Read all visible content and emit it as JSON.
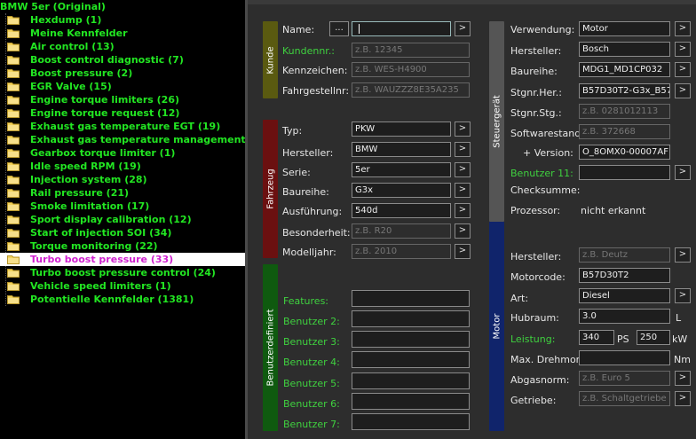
{
  "tree": {
    "root": "BMW 5er (Original)",
    "items": [
      "Hexdump (1)",
      "Meine Kennfelder",
      "Air control (13)",
      "Boost control diagnostic (7)",
      "Boost pressure (2)",
      "EGR Valve (15)",
      "Engine torque limiters (26)",
      "Engine torque request (12)",
      "Exhaust gas temperature EGT (19)",
      "Exhaust gas temperature management (2)",
      "Gearbox torque limiter (1)",
      "Idle speed RPM (19)",
      "Injection system (28)",
      "Rail pressure (21)",
      "Smoke limitation (17)",
      "Sport display calibration (12)",
      "Start of injection SOI (34)",
      "Torque monitoring (22)",
      "Turbo boost pressure (33)",
      "Turbo boost pressure control (24)",
      "Vehicle speed limiters (1)",
      "Potentielle Kennfelder (1381)"
    ],
    "selected_index": 18
  },
  "colors": {
    "kunde": "#5a5a10",
    "fahrzeug": "#6b1010",
    "benutzer": "#0f5a0f",
    "steuergeraet": "#555555",
    "motor": "#10246b",
    "tree_text": "#22e622",
    "tree_selected": "#d020d0"
  },
  "kunde": {
    "tab": "Kunde",
    "name_label": "Name:",
    "name_btn": "...",
    "name_value": "",
    "kundennr_label": "Kundennr.:",
    "kundennr_ph": "z.B. 12345",
    "kennzeichen_label": "Kennzeichen:",
    "kennzeichen_ph": "z.B. WES-H4900",
    "fahrgestell_label": "Fahrgestellnr:",
    "fahrgestell_ph": "z.B. WAUZZZ8E35A235"
  },
  "fahrzeug": {
    "tab": "Fahrzeug",
    "typ_label": "Typ:",
    "typ": "PKW",
    "hersteller_label": "Hersteller:",
    "hersteller": "BMW",
    "serie_label": "Serie:",
    "serie": "5er",
    "baureihe_label": "Baureihe:",
    "baureihe": "G3x",
    "ausfuehrung_label": "Ausführung:",
    "ausfuehrung": "540d",
    "besonderheit_label": "Besonderheit:",
    "besonderheit_ph": "z.B. R20",
    "modelljahr_label": "Modelljahr:",
    "modelljahr_ph": "z.B. 2010"
  },
  "benutzer": {
    "tab": "Benutzerdefiniert",
    "labels": [
      "Features:",
      "Benutzer 2:",
      "Benutzer 3:",
      "Benutzer 4:",
      "Benutzer 5:",
      "Benutzer 6:",
      "Benutzer 7:"
    ]
  },
  "steuergeraet": {
    "tab": "Steuergerät",
    "verwendung_label": "Verwendung:",
    "verwendung": "Motor",
    "hersteller_label": "Hersteller:",
    "hersteller": "Bosch",
    "baureihe_label": "Baureihe:",
    "baureihe": "MDG1_MD1CP032",
    "stgnr_her_label": "Stgnr.Her.:",
    "stgnr_her": "B57D30T2-G3x_B57",
    "stgnr_stg_label": "Stgnr.Stg.:",
    "stgnr_stg_ph": "z.B. 0281012113",
    "softwarestand_label": "Softwarestand:",
    "softwarestand_ph": "z.B. 372668",
    "version_label": "+ Version:",
    "version": "O_8OMX0-00007AF",
    "benutzer11_label": "Benutzer 11:",
    "checksumme_label": "Checksumme:",
    "prozessor_label": "Prozessor:",
    "prozessor": "nicht erkannt"
  },
  "motor": {
    "tab": "Motor",
    "hersteller_label": "Hersteller:",
    "hersteller_ph": "z.B. Deutz",
    "motorcode_label": "Motorcode:",
    "motorcode": "B57D30T2",
    "art_label": "Art:",
    "art": "Diesel",
    "hubraum_label": "Hubraum:",
    "hubraum": "3.0",
    "hubraum_unit": "L",
    "leistung_label": "Leistung:",
    "leistung_ps": "340",
    "ps_unit": "PS",
    "leistung_kw": "250",
    "kw_unit": "kW",
    "drehmom_label": "Max. Drehmom.:",
    "drehmom_unit": "Nm",
    "abgasnorm_label": "Abgasnorm:",
    "abgasnorm_ph": "z.B. Euro 5",
    "getriebe_label": "Getriebe:",
    "getriebe_ph": "z.B. Schaltgetriebe"
  },
  "button_glyph": ">"
}
